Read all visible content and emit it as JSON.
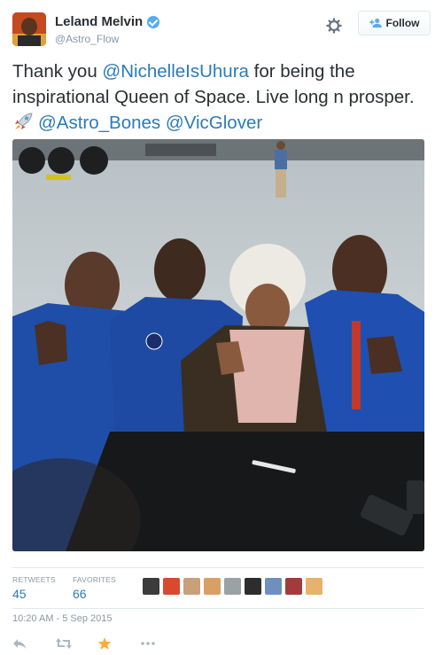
{
  "user": {
    "display_name": "Leland Melvin",
    "handle": "@Astro_Flow",
    "verified": true
  },
  "header": {
    "follow_label": "Follow",
    "settings_icon": "gear-icon",
    "follow_icon": "add-user-icon"
  },
  "tweet": {
    "text_before": "Thank you ",
    "mention_1": "@NichelleIsUhura",
    "text_middle": " for being the inspirational Queen of Space. Live long n prosper.",
    "emoji_icon": "rocket-icon",
    "mention_2": "@Astro_Bones",
    "mention_3": "@VicGlover"
  },
  "stats": {
    "retweets_label": "RETWEETS",
    "retweets_value": "45",
    "favorites_label": "FAVORITES",
    "favorites_value": "66"
  },
  "meta": {
    "timestamp": "10:20 AM - 5 Sep 2015"
  },
  "actions": {
    "reply_icon": "reply-icon",
    "retweet_icon": "retweet-icon",
    "favorite_icon": "star-icon",
    "more_icon": "more-icon"
  },
  "colors": {
    "link": "#2b7bb9",
    "muted": "#8899a6",
    "verified": "#55acee",
    "favorite_active": "#ffac33"
  }
}
